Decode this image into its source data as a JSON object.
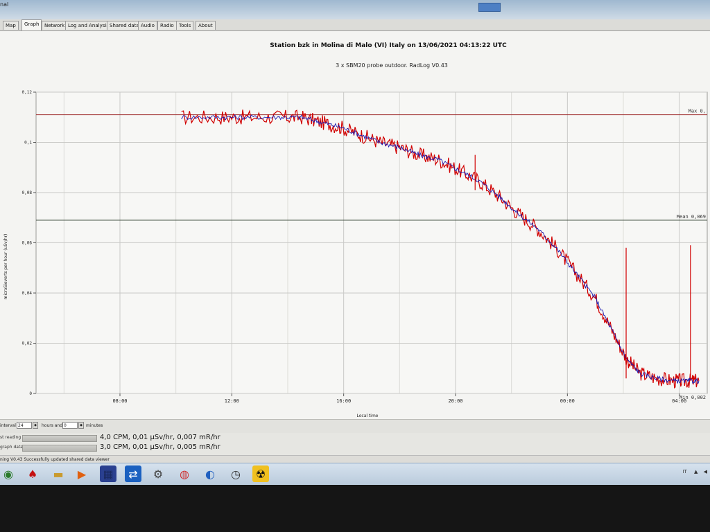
{
  "window": {
    "title_fragment": "nal"
  },
  "tabs": [
    {
      "label": "Map",
      "active": false
    },
    {
      "label": "Graph",
      "active": true
    },
    {
      "label": "Network",
      "active": false
    },
    {
      "label": "Log and Analysis",
      "active": false
    },
    {
      "label": "Shared data",
      "active": false
    },
    {
      "label": "Audio",
      "active": false
    },
    {
      "label": "Radio",
      "active": false
    },
    {
      "label": "Tools",
      "active": false
    },
    {
      "label": "About",
      "active": false
    }
  ],
  "colors": {
    "accent": "#c8102e",
    "series_fast": "#d10000",
    "series_avg": "#1a1ab0",
    "max_line": "#a03030",
    "mean_line": "#2f3f2f",
    "grid": "#c9c9c6"
  },
  "chart_data": {
    "type": "line",
    "title": "Station bzk in Molina di Malo (VI)   Italy on 13/06/2021 04:13:22 UTC",
    "subtitle": "3 x SBM20 probe outdoor. RadLog V0.43",
    "xlabel": "Local time",
    "ylabel": "microSieverts per hour (uSv/hr)",
    "x_tick_labels": [
      "08:00",
      "12:00",
      "16:00",
      "20:00",
      "00:00",
      "04:00"
    ],
    "y_tick_labels": [
      "0",
      "0,02",
      "0,04",
      "0,06",
      "0,08",
      "0,1",
      "0,12"
    ],
    "ylim": [
      0,
      0.12
    ],
    "xlim_hours": [
      5,
      29
    ],
    "grid": true,
    "reference_lines": [
      {
        "label": "Max 0,",
        "value": 0.111
      },
      {
        "label": "Mean 0,069",
        "value": 0.069
      },
      {
        "label": "Min 0,002",
        "value": 0.0
      }
    ],
    "series": [
      {
        "name": "",
        "color": "#d10000",
        "x": [
          10.2,
          11.5,
          12.5,
          13.7,
          14.5,
          15.2,
          15.9,
          16.6,
          17.3,
          18.0,
          18.7,
          19.4,
          20.1,
          20.8,
          21.5,
          22.2,
          22.9,
          23.6,
          24.3,
          25.0,
          25.6,
          26.1,
          26.6,
          27.2,
          27.8,
          28.3,
          28.7
        ],
        "y": [
          0.11,
          0.11,
          0.11,
          0.11,
          0.11,
          0.108,
          0.106,
          0.103,
          0.1,
          0.098,
          0.095,
          0.093,
          0.089,
          0.085,
          0.079,
          0.072,
          0.066,
          0.058,
          0.048,
          0.038,
          0.025,
          0.014,
          0.008,
          0.006,
          0.005,
          0.005,
          0.005
        ]
      },
      {
        "name": "",
        "color": "#1a1ab0",
        "x": [
          10.2,
          11.5,
          12.5,
          13.7,
          14.5,
          15.2,
          15.9,
          16.6,
          17.3,
          18.0,
          18.7,
          19.4,
          20.1,
          20.8,
          21.5,
          22.2,
          22.9,
          23.6,
          24.3,
          25.0,
          25.6,
          26.1,
          26.6,
          27.2,
          27.8,
          28.3,
          28.7
        ],
        "y": [
          0.11,
          0.11,
          0.11,
          0.11,
          0.11,
          0.108,
          0.106,
          0.103,
          0.1,
          0.098,
          0.095,
          0.093,
          0.089,
          0.085,
          0.079,
          0.072,
          0.066,
          0.058,
          0.048,
          0.038,
          0.025,
          0.014,
          0.008,
          0.006,
          0.005,
          0.005,
          0.005
        ]
      }
    ],
    "spikes": [
      {
        "x": 20.7,
        "y": 0.095
      },
      {
        "x": 26.1,
        "y": 0.058
      },
      {
        "x": 28.4,
        "y": 0.059
      }
    ]
  },
  "controls": {
    "interval_label": "interval",
    "interval_value": "24",
    "hours_label": "hours and",
    "minutes_value": "0",
    "minutes_label": "minutes"
  },
  "readings": [
    {
      "label": "st reading",
      "value": "4,0 CPM, 0,01 µSv/hr, 0,007 mR/hr"
    },
    {
      "label": "graph data",
      "value": "3,0 CPM, 0,01 µSv/hr, 0,005 mR/hr"
    }
  ],
  "status": {
    "text": "ning  V0.43  Successfully updated shared data viewer"
  },
  "taskbar": {
    "icons": [
      "start-icon",
      "acrobat-icon",
      "folder-icon",
      "media-player-icon",
      "network-icon",
      "sync-icon",
      "settings-icon",
      "chrome-icon",
      "browser-icon",
      "clock-app-icon",
      "radiation-icon"
    ],
    "tray_text": "IT"
  }
}
